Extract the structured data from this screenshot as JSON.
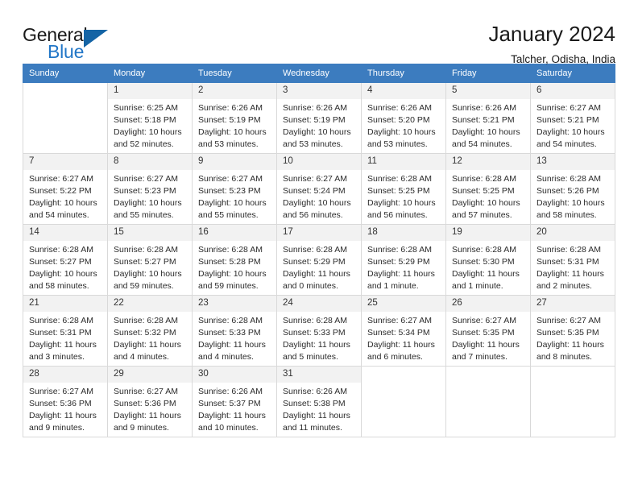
{
  "brand": {
    "name_part1": "General",
    "name_part2": "Blue",
    "triangle_icon": "blue-triangle-icon",
    "accent_color": "#2176c7",
    "triangle_color": "#1464a5"
  },
  "header": {
    "title": "January 2024",
    "subtitle": "Talcher, Odisha, India"
  },
  "calendar": {
    "header_bg": "#3c7cbf",
    "daynum_bg": "#f2f2f2",
    "weekdays": [
      "Sunday",
      "Monday",
      "Tuesday",
      "Wednesday",
      "Thursday",
      "Friday",
      "Saturday"
    ],
    "weeks": [
      [
        {
          "day": "",
          "sunrise": "",
          "sunset": "",
          "daylight": "",
          "empty": true
        },
        {
          "day": "1",
          "sunrise": "Sunrise: 6:25 AM",
          "sunset": "Sunset: 5:18 PM",
          "daylight": "Daylight: 10 hours and 52 minutes."
        },
        {
          "day": "2",
          "sunrise": "Sunrise: 6:26 AM",
          "sunset": "Sunset: 5:19 PM",
          "daylight": "Daylight: 10 hours and 53 minutes."
        },
        {
          "day": "3",
          "sunrise": "Sunrise: 6:26 AM",
          "sunset": "Sunset: 5:19 PM",
          "daylight": "Daylight: 10 hours and 53 minutes."
        },
        {
          "day": "4",
          "sunrise": "Sunrise: 6:26 AM",
          "sunset": "Sunset: 5:20 PM",
          "daylight": "Daylight: 10 hours and 53 minutes."
        },
        {
          "day": "5",
          "sunrise": "Sunrise: 6:26 AM",
          "sunset": "Sunset: 5:21 PM",
          "daylight": "Daylight: 10 hours and 54 minutes."
        },
        {
          "day": "6",
          "sunrise": "Sunrise: 6:27 AM",
          "sunset": "Sunset: 5:21 PM",
          "daylight": "Daylight: 10 hours and 54 minutes."
        }
      ],
      [
        {
          "day": "7",
          "sunrise": "Sunrise: 6:27 AM",
          "sunset": "Sunset: 5:22 PM",
          "daylight": "Daylight: 10 hours and 54 minutes."
        },
        {
          "day": "8",
          "sunrise": "Sunrise: 6:27 AM",
          "sunset": "Sunset: 5:23 PM",
          "daylight": "Daylight: 10 hours and 55 minutes."
        },
        {
          "day": "9",
          "sunrise": "Sunrise: 6:27 AM",
          "sunset": "Sunset: 5:23 PM",
          "daylight": "Daylight: 10 hours and 55 minutes."
        },
        {
          "day": "10",
          "sunrise": "Sunrise: 6:27 AM",
          "sunset": "Sunset: 5:24 PM",
          "daylight": "Daylight: 10 hours and 56 minutes."
        },
        {
          "day": "11",
          "sunrise": "Sunrise: 6:28 AM",
          "sunset": "Sunset: 5:25 PM",
          "daylight": "Daylight: 10 hours and 56 minutes."
        },
        {
          "day": "12",
          "sunrise": "Sunrise: 6:28 AM",
          "sunset": "Sunset: 5:25 PM",
          "daylight": "Daylight: 10 hours and 57 minutes."
        },
        {
          "day": "13",
          "sunrise": "Sunrise: 6:28 AM",
          "sunset": "Sunset: 5:26 PM",
          "daylight": "Daylight: 10 hours and 58 minutes."
        }
      ],
      [
        {
          "day": "14",
          "sunrise": "Sunrise: 6:28 AM",
          "sunset": "Sunset: 5:27 PM",
          "daylight": "Daylight: 10 hours and 58 minutes."
        },
        {
          "day": "15",
          "sunrise": "Sunrise: 6:28 AM",
          "sunset": "Sunset: 5:27 PM",
          "daylight": "Daylight: 10 hours and 59 minutes."
        },
        {
          "day": "16",
          "sunrise": "Sunrise: 6:28 AM",
          "sunset": "Sunset: 5:28 PM",
          "daylight": "Daylight: 10 hours and 59 minutes."
        },
        {
          "day": "17",
          "sunrise": "Sunrise: 6:28 AM",
          "sunset": "Sunset: 5:29 PM",
          "daylight": "Daylight: 11 hours and 0 minutes."
        },
        {
          "day": "18",
          "sunrise": "Sunrise: 6:28 AM",
          "sunset": "Sunset: 5:29 PM",
          "daylight": "Daylight: 11 hours and 1 minute."
        },
        {
          "day": "19",
          "sunrise": "Sunrise: 6:28 AM",
          "sunset": "Sunset: 5:30 PM",
          "daylight": "Daylight: 11 hours and 1 minute."
        },
        {
          "day": "20",
          "sunrise": "Sunrise: 6:28 AM",
          "sunset": "Sunset: 5:31 PM",
          "daylight": "Daylight: 11 hours and 2 minutes."
        }
      ],
      [
        {
          "day": "21",
          "sunrise": "Sunrise: 6:28 AM",
          "sunset": "Sunset: 5:31 PM",
          "daylight": "Daylight: 11 hours and 3 minutes."
        },
        {
          "day": "22",
          "sunrise": "Sunrise: 6:28 AM",
          "sunset": "Sunset: 5:32 PM",
          "daylight": "Daylight: 11 hours and 4 minutes."
        },
        {
          "day": "23",
          "sunrise": "Sunrise: 6:28 AM",
          "sunset": "Sunset: 5:33 PM",
          "daylight": "Daylight: 11 hours and 4 minutes."
        },
        {
          "day": "24",
          "sunrise": "Sunrise: 6:28 AM",
          "sunset": "Sunset: 5:33 PM",
          "daylight": "Daylight: 11 hours and 5 minutes."
        },
        {
          "day": "25",
          "sunrise": "Sunrise: 6:27 AM",
          "sunset": "Sunset: 5:34 PM",
          "daylight": "Daylight: 11 hours and 6 minutes."
        },
        {
          "day": "26",
          "sunrise": "Sunrise: 6:27 AM",
          "sunset": "Sunset: 5:35 PM",
          "daylight": "Daylight: 11 hours and 7 minutes."
        },
        {
          "day": "27",
          "sunrise": "Sunrise: 6:27 AM",
          "sunset": "Sunset: 5:35 PM",
          "daylight": "Daylight: 11 hours and 8 minutes."
        }
      ],
      [
        {
          "day": "28",
          "sunrise": "Sunrise: 6:27 AM",
          "sunset": "Sunset: 5:36 PM",
          "daylight": "Daylight: 11 hours and 9 minutes."
        },
        {
          "day": "29",
          "sunrise": "Sunrise: 6:27 AM",
          "sunset": "Sunset: 5:36 PM",
          "daylight": "Daylight: 11 hours and 9 minutes."
        },
        {
          "day": "30",
          "sunrise": "Sunrise: 6:26 AM",
          "sunset": "Sunset: 5:37 PM",
          "daylight": "Daylight: 11 hours and 10 minutes."
        },
        {
          "day": "31",
          "sunrise": "Sunrise: 6:26 AM",
          "sunset": "Sunset: 5:38 PM",
          "daylight": "Daylight: 11 hours and 11 minutes."
        },
        {
          "day": "",
          "sunrise": "",
          "sunset": "",
          "daylight": "",
          "empty": true
        },
        {
          "day": "",
          "sunrise": "",
          "sunset": "",
          "daylight": "",
          "empty": true
        },
        {
          "day": "",
          "sunrise": "",
          "sunset": "",
          "daylight": "",
          "empty": true
        }
      ]
    ]
  }
}
